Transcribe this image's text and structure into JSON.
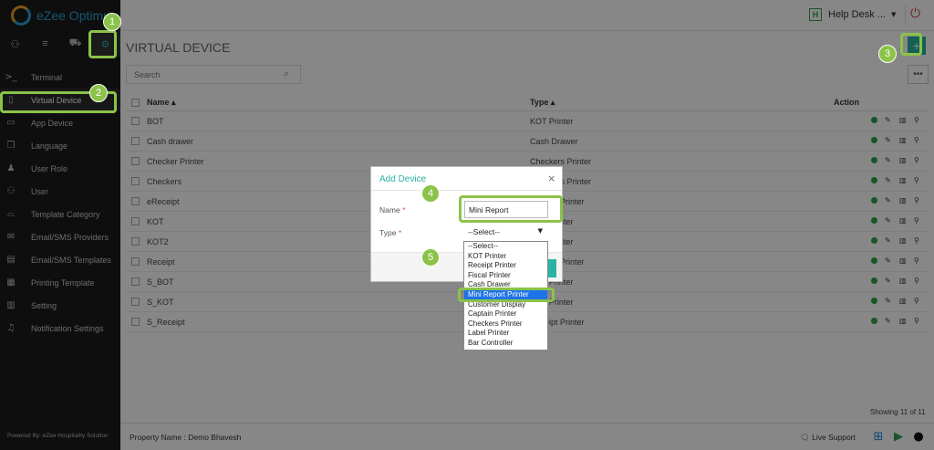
{
  "app": {
    "brand": "eZee Optimus"
  },
  "sidebar": {
    "top_icons": [
      {
        "icon": "user-icon",
        "glyph": "⚇"
      },
      {
        "icon": "list-icon",
        "glyph": "≡"
      },
      {
        "icon": "cart-icon",
        "glyph": "⛟"
      },
      {
        "icon": "gear-icon",
        "glyph": "⚙"
      }
    ],
    "items": [
      {
        "label": "Terminal",
        "icon": "terminal-icon",
        "glyph": ">_"
      },
      {
        "label": "Virtual Device",
        "icon": "virtual-device-icon",
        "glyph": "▯"
      },
      {
        "label": "App Device",
        "icon": "app-device-icon",
        "glyph": "▭"
      },
      {
        "label": "Language",
        "icon": "language-icon",
        "glyph": "❐"
      },
      {
        "label": "User Role",
        "icon": "user-role-icon",
        "glyph": "♟"
      },
      {
        "label": "User",
        "icon": "user-icon",
        "glyph": "⚇"
      },
      {
        "label": "Template Category",
        "icon": "template-category-icon",
        "glyph": "⌓"
      },
      {
        "label": "Email/SMS Providers",
        "icon": "email-icon",
        "glyph": "✉"
      },
      {
        "label": "Email/SMS Templates",
        "icon": "email-template-icon",
        "glyph": "▤"
      },
      {
        "label": "Printing Template",
        "icon": "printing-template-icon",
        "glyph": "▦"
      },
      {
        "label": "Setting",
        "icon": "setting-icon",
        "glyph": "▥"
      },
      {
        "label": "Notification Settings",
        "icon": "bell-icon",
        "glyph": "♫"
      }
    ],
    "powered_by": "Powered By: eZee Hospitality Solution"
  },
  "header": {
    "help_badge": "H",
    "help_label": "Help Desk ...",
    "power_glyph": "⏻"
  },
  "main": {
    "title": "VIRTUAL DEVICE",
    "add_label": "+",
    "search_placeholder": "Search",
    "more_label": "•••",
    "columns": {
      "name": "Name ▴",
      "type": "Type ▴",
      "action": "Action"
    },
    "rows": [
      {
        "name": "BOT",
        "type": "KOT Printer"
      },
      {
        "name": "Cash drawer",
        "type": "Cash Drawer"
      },
      {
        "name": "Checker Printer",
        "type": "Checkers Printer"
      },
      {
        "name": "Checkers",
        "type": "Checkers Printer"
      },
      {
        "name": "eReceipt",
        "type": "Receipt Printer"
      },
      {
        "name": "KOT",
        "type": "KOT Printer"
      },
      {
        "name": "KOT2",
        "type": "KOT Printer"
      },
      {
        "name": "Receipt",
        "type": "Receipt Printer"
      },
      {
        "name": "S_BOT",
        "type": "KOT Printer"
      },
      {
        "name": "S_KOT",
        "type": "KOT Printer"
      },
      {
        "name": "S_Receipt",
        "type": "Receipt Printer"
      }
    ],
    "showing": "Showing 11 of 11"
  },
  "footer": {
    "property": "Property Name : Demo Bhavesh",
    "live_support": "🗨 Live Support"
  },
  "modal": {
    "title": "Add Device",
    "close": "×",
    "name_label": "Name",
    "type_label": "Type",
    "required_mark": "*",
    "name_value": "Mini Report",
    "type_value": "--Select--",
    "type_caret": "▼",
    "options": [
      "--Select--",
      "KOT Printer",
      "Receipt Printer",
      "Fiscal Printer",
      "Cash Drawer",
      "Mini Report Printer",
      "Customer Display",
      "Captain Printer",
      "Checkers Printer",
      "Label Printer",
      "Bar Controller"
    ],
    "highlighted_option": "Mini Report Printer"
  },
  "callouts": [
    "1",
    "2",
    "3",
    "4",
    "5"
  ],
  "colors": {
    "accent": "#2ab3a3",
    "callout": "#8bc34a",
    "status_on": "#2aa34a",
    "danger": "#d04040"
  }
}
